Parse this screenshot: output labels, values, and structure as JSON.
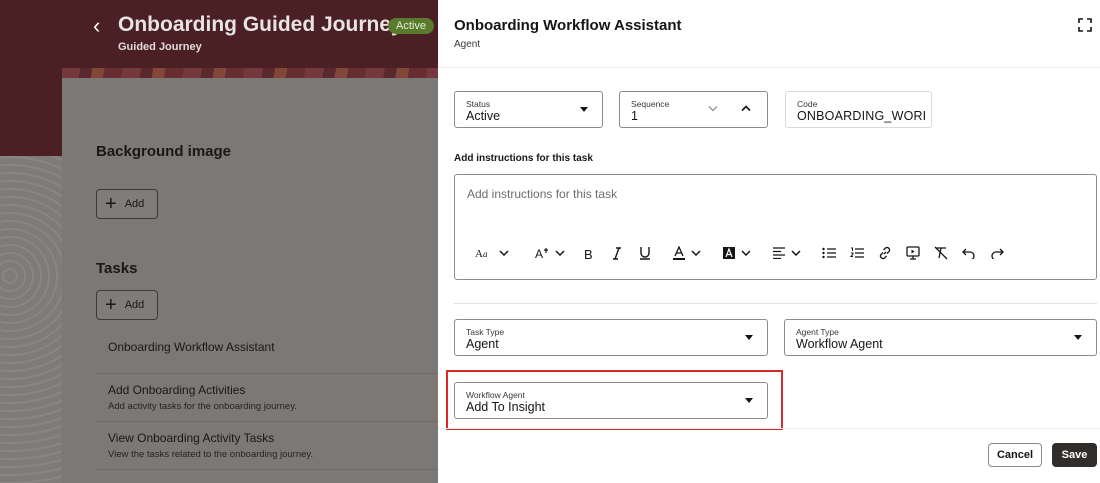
{
  "page": {
    "title": "Onboarding Guided Journey",
    "status_badge": "Active",
    "subtitle": "Guided Journey",
    "background_image_heading": "Background image",
    "add_label": "Add",
    "tasks_heading": "Tasks",
    "tasks": [
      {
        "name": "Onboarding Workflow Assistant",
        "desc": ""
      },
      {
        "name": "Add Onboarding Activities",
        "desc": "Add activity tasks for the onboarding journey."
      },
      {
        "name": "View Onboarding Activity Tasks",
        "desc": "View the tasks related to the onboarding journey."
      }
    ]
  },
  "drawer": {
    "title": "Onboarding Workflow Assistant",
    "subtitle": "Agent",
    "status": {
      "label": "Status",
      "value": "Active"
    },
    "sequence": {
      "label": "Sequence",
      "value": "1"
    },
    "code": {
      "label": "Code",
      "value": "ONBOARDING_WORKFLOW_ASSISTANT"
    },
    "instructions_label": "Add instructions for this task",
    "instructions_placeholder": "Add instructions for this task",
    "toolbar_icons": [
      "font-size-icon",
      "text-size-icon",
      "bold-icon",
      "italic-icon",
      "underline-icon",
      "font-color-icon",
      "highlight-color-icon",
      "align-icon",
      "bulleted-list-icon",
      "numbered-list-icon",
      "link-icon",
      "insert-media-icon",
      "clear-formatting-icon",
      "undo-icon",
      "redo-icon"
    ],
    "task_type": {
      "label": "Task Type",
      "value": "Agent"
    },
    "agent_type": {
      "label": "Agent Type",
      "value": "Workflow Agent"
    },
    "workflow_agent": {
      "label": "Workflow Agent",
      "value": "Add To Insight"
    },
    "cancel_label": "Cancel",
    "save_label": "Save"
  },
  "colors": {
    "highlight": "#d52b2b",
    "save_button": "#312d2a",
    "badge": "#5a7a2e",
    "banner": "#4a2024"
  }
}
